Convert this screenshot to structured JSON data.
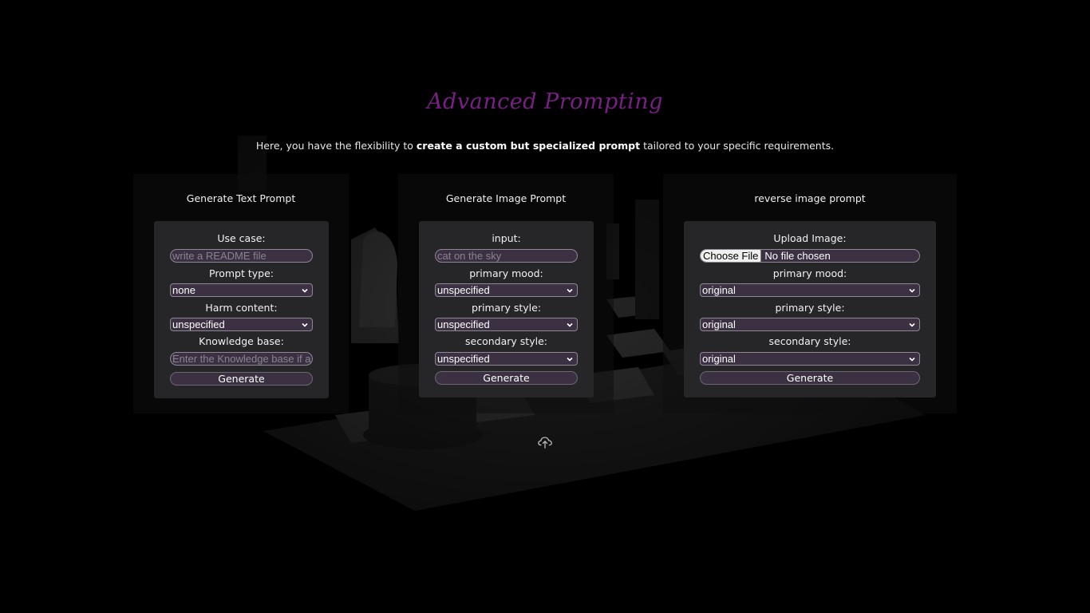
{
  "page": {
    "title": "Advanced Prompting",
    "subtitle_pre": "Here, you have the flexibility to ",
    "subtitle_bold": "create a custom but specialized prompt",
    "subtitle_post": " tailored to your specific requirements."
  },
  "text_prompt": {
    "heading": "Generate Text Prompt",
    "use_case_label": "Use case:",
    "use_case_placeholder": "write a README file",
    "prompt_type_label": "Prompt type:",
    "prompt_type_value": "none",
    "harm_content_label": "Harm content:",
    "harm_content_value": "unspecified",
    "knowledge_base_label": "Knowledge base:",
    "knowledge_base_placeholder": "Enter the Knowledge base if a",
    "generate_label": "Generate"
  },
  "image_prompt": {
    "heading": "Generate Image Prompt",
    "input_label": "input:",
    "input_placeholder": "cat on the sky",
    "primary_mood_label": "primary mood:",
    "primary_mood_value": "unspecified",
    "primary_style_label": "primary style:",
    "primary_style_value": "unspecified",
    "secondary_style_label": "secondary style:",
    "secondary_style_value": "unspecified",
    "generate_label": "Generate"
  },
  "reverse_prompt": {
    "heading": "reverse image prompt",
    "upload_label": "Upload Image:",
    "choose_file_label": "Choose File",
    "no_file_text": "No file chosen",
    "primary_mood_label": "primary mood:",
    "primary_mood_value": "original",
    "primary_style_label": "primary style:",
    "primary_style_value": "original",
    "secondary_style_label": "secondary style:",
    "secondary_style_value": "original",
    "generate_label": "Generate"
  },
  "icons": {
    "upload": "cloud-upload-icon",
    "dropdown": "chevron-down-icon"
  },
  "colors": {
    "title": "#7a1f86",
    "card_background": "#262528",
    "control_background": "#3b3142"
  }
}
